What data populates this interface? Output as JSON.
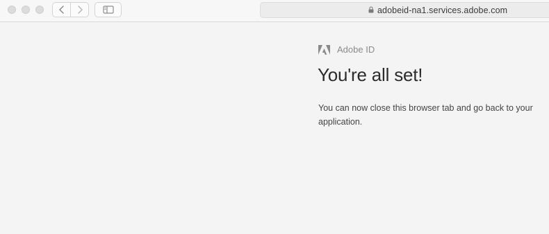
{
  "browser": {
    "url": "adobeid-na1.services.adobe.com",
    "icons": {
      "close": "traffic-light",
      "minimize": "traffic-light",
      "zoom": "traffic-light",
      "back": "chevron-left-icon",
      "forward": "chevron-right-icon",
      "sidebar": "sidebar-icon",
      "lock": "lock-icon"
    }
  },
  "page": {
    "brand": "Adobe ID",
    "headline": "You're all set!",
    "message": "You can now close this browser tab and go back to your application."
  },
  "colors": {
    "background": "#f4f4f4",
    "toolbar": "#f7f7f7",
    "address_bar": "#ececec",
    "logo": "#8a8a8a",
    "headline": "#2c2c2c",
    "body_text": "#444444"
  }
}
